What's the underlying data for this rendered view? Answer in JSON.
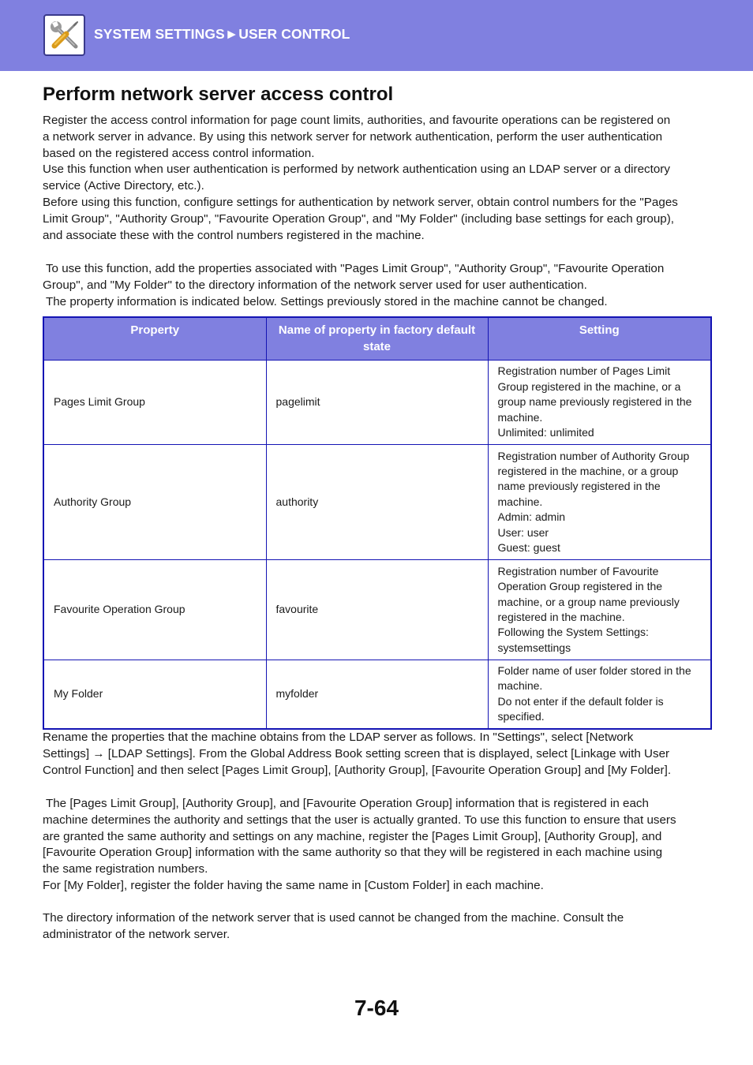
{
  "header": {
    "icon": "tools-wrench-screwdriver-icon",
    "breadcrumb": "SYSTEM SETTINGS►USER CONTROL",
    "background_color": "#8080e0"
  },
  "page_title": "Perform network server access control",
  "intro_paragraph": {
    "lines": [
      "Register the access control information for page count limits, authorities, and favourite operations can be registered on",
      "a network server in advance. By using this network server for network authentication, perform the user authentication",
      "based on the registered access control information.",
      "Use this function when user authentication is performed by network authentication using an LDAP server or a directory",
      "service (Active Directory, etc.).",
      "Before using this function, configure settings for authentication by network server, obtain control numbers for the \"Pages",
      "Limit Group\", \"Authority Group\", \"Favourite Operation Group\", and \"My Folder\" (including base settings for each group),",
      "and associate these with the control numbers registered in the machine."
    ]
  },
  "properties_paragraph": {
    "lines": [
      " To use this function, add the properties associated with \"Pages Limit Group\", \"Authority Group\", \"Favourite Operation",
      "Group\", and \"My Folder\" to the directory information of the network server used for user authentication.",
      " The property information is indicated below. Settings previously stored in the machine cannot be changed."
    ]
  },
  "table": {
    "headers": [
      "Property",
      "Name of property in factory default state",
      "Setting"
    ],
    "header_color": "#8080e0",
    "border_color": "#1414b4",
    "rows": [
      {
        "property": "Pages Limit Group",
        "factory_name": "pagelimit",
        "setting_lines": [
          "Registration number of Pages Limit",
          "Group registered in the machine, or a",
          "group name previously registered in the",
          "machine.",
          "Unlimited: unlimited"
        ]
      },
      {
        "property": "Authority Group",
        "factory_name": "authority",
        "setting_lines": [
          "Registration number of Authority Group",
          "registered in the machine, or a group",
          "name previously registered in the",
          "machine.",
          "Admin: admin",
          "User: user",
          "Guest: guest"
        ]
      },
      {
        "property": "Favourite Operation Group",
        "factory_name": "favourite",
        "setting_lines": [
          "Registration number of Favourite",
          "Operation Group registered in the",
          "machine, or a group name previously",
          "registered in the machine.",
          "Following the System Settings:",
          "systemsettings"
        ]
      },
      {
        "property": "My Folder",
        "factory_name": "myfolder",
        "setting_lines": [
          "Folder name of user folder stored in the",
          "machine.",
          "Do not enter if the default folder is",
          "specified."
        ]
      }
    ]
  },
  "rename_paragraph": {
    "lines": [
      "Rename the properties that the machine obtains from the LDAP server as follows. In \"Settings\", select [Network",
      "Settings] → [LDAP Settings]. From the Global Address Book setting screen that is displayed, select [Linkage with User",
      "Control Function] and then select [Pages Limit Group], [Authority Group], [Favourite Operation Group] and [My Folder]."
    ]
  },
  "registration_paragraph": {
    "lines": [
      " The [Pages Limit Group], [Authority Group], and [Favourite Operation Group] information that is registered in each",
      "machine determines the authority and settings that the user is actually granted. To use this function to ensure that users",
      "are granted the same authority and settings on any machine, register the [Pages Limit Group], [Authority Group], and",
      "[Favourite Operation Group] information with the same authority so that they will be registered in each machine using",
      "the same registration numbers.",
      "For [My Folder], register the folder having the same name in [Custom Folder] in each machine."
    ]
  },
  "directory_paragraph": {
    "lines": [
      "The directory information of the network server that is used cannot be changed from the machine. Consult the",
      "administrator of the network server."
    ]
  },
  "page_number": "7-64"
}
